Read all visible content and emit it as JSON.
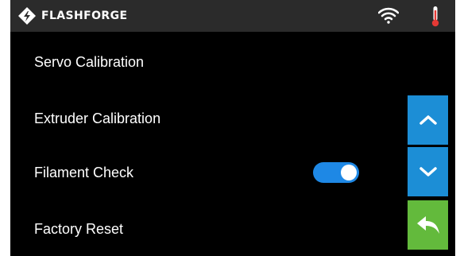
{
  "header": {
    "brand_name": "FLASHFORGE",
    "logo_icon": "flashforge-logo-icon",
    "wifi_icon": "wifi-icon",
    "temperature_icon": "thermometer-icon",
    "temperature_color": "#e53935"
  },
  "menu": {
    "items": [
      {
        "label": "Servo Calibration"
      },
      {
        "label": "Extruder Calibration"
      },
      {
        "label": "Filament Check",
        "toggle": true
      },
      {
        "label": "Factory Reset"
      }
    ]
  },
  "navigation": {
    "up_icon": "chevron-up-icon",
    "down_icon": "chevron-down-icon",
    "back_icon": "back-arrow-icon",
    "scroll_color": "#1c8ed6",
    "back_color": "#63ba3c"
  },
  "colors": {
    "toggle_on": "#1e88e5",
    "background": "#000000",
    "topbar": "#2b2b2b"
  }
}
